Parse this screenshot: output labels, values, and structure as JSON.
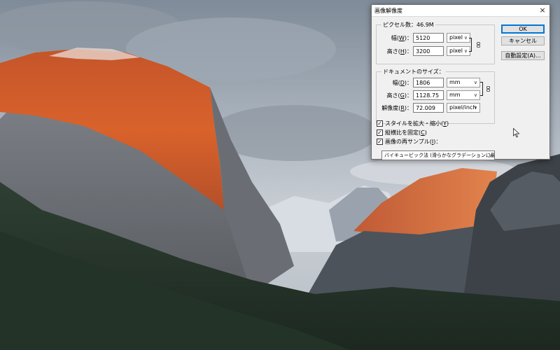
{
  "dialog": {
    "title": "画像解像度",
    "close_label": "×",
    "pixel_group": {
      "legend": "ピクセル数：46.9M",
      "width": {
        "label": "幅(",
        "mnemonic": "W",
        "suffix": ")：",
        "value": "5120",
        "unit": "pixel"
      },
      "height": {
        "label": "高さ(",
        "mnemonic": "H",
        "suffix": ")：",
        "value": "3200",
        "unit": "pixel"
      }
    },
    "doc_group": {
      "legend": "ドキュメントのサイズ：",
      "width": {
        "label": "幅(",
        "mnemonic": "D",
        "suffix": ")：",
        "value": "1806",
        "unit": "mm"
      },
      "height": {
        "label": "高さ(",
        "mnemonic": "G",
        "suffix": ")：",
        "value": "1128.75",
        "unit": "mm"
      },
      "resolution": {
        "label": "解像度(",
        "mnemonic": "R",
        "suffix": ")：",
        "value": "72.009",
        "unit": "pixel/inch"
      }
    },
    "buttons": {
      "ok": "OK",
      "cancel": "キャンセル",
      "auto": "自動設定(A)..."
    },
    "checkboxes": [
      {
        "label": "スタイルを拡大・縮小(",
        "mnemonic": "Y",
        "suffix": ")",
        "checked": true
      },
      {
        "label": "縦横比を固定(",
        "mnemonic": "C",
        "suffix": ")",
        "checked": true
      },
      {
        "label": "画像の再サンプル(",
        "mnemonic": "I",
        "suffix": ")：",
        "checked": true
      }
    ],
    "resample_method": "バイキュービック法 (滑らかなグラデーションに最適)"
  },
  "icons": {
    "close": "close-icon",
    "link": "chain-link-icon",
    "dropdown": "chevron-down-icon",
    "cursor": "mouse-pointer-icon"
  },
  "colors": {
    "dialog_bg": "#f0f0f0",
    "default_button_border": "#0078d7",
    "sunlit_rock": "#d9622b"
  }
}
